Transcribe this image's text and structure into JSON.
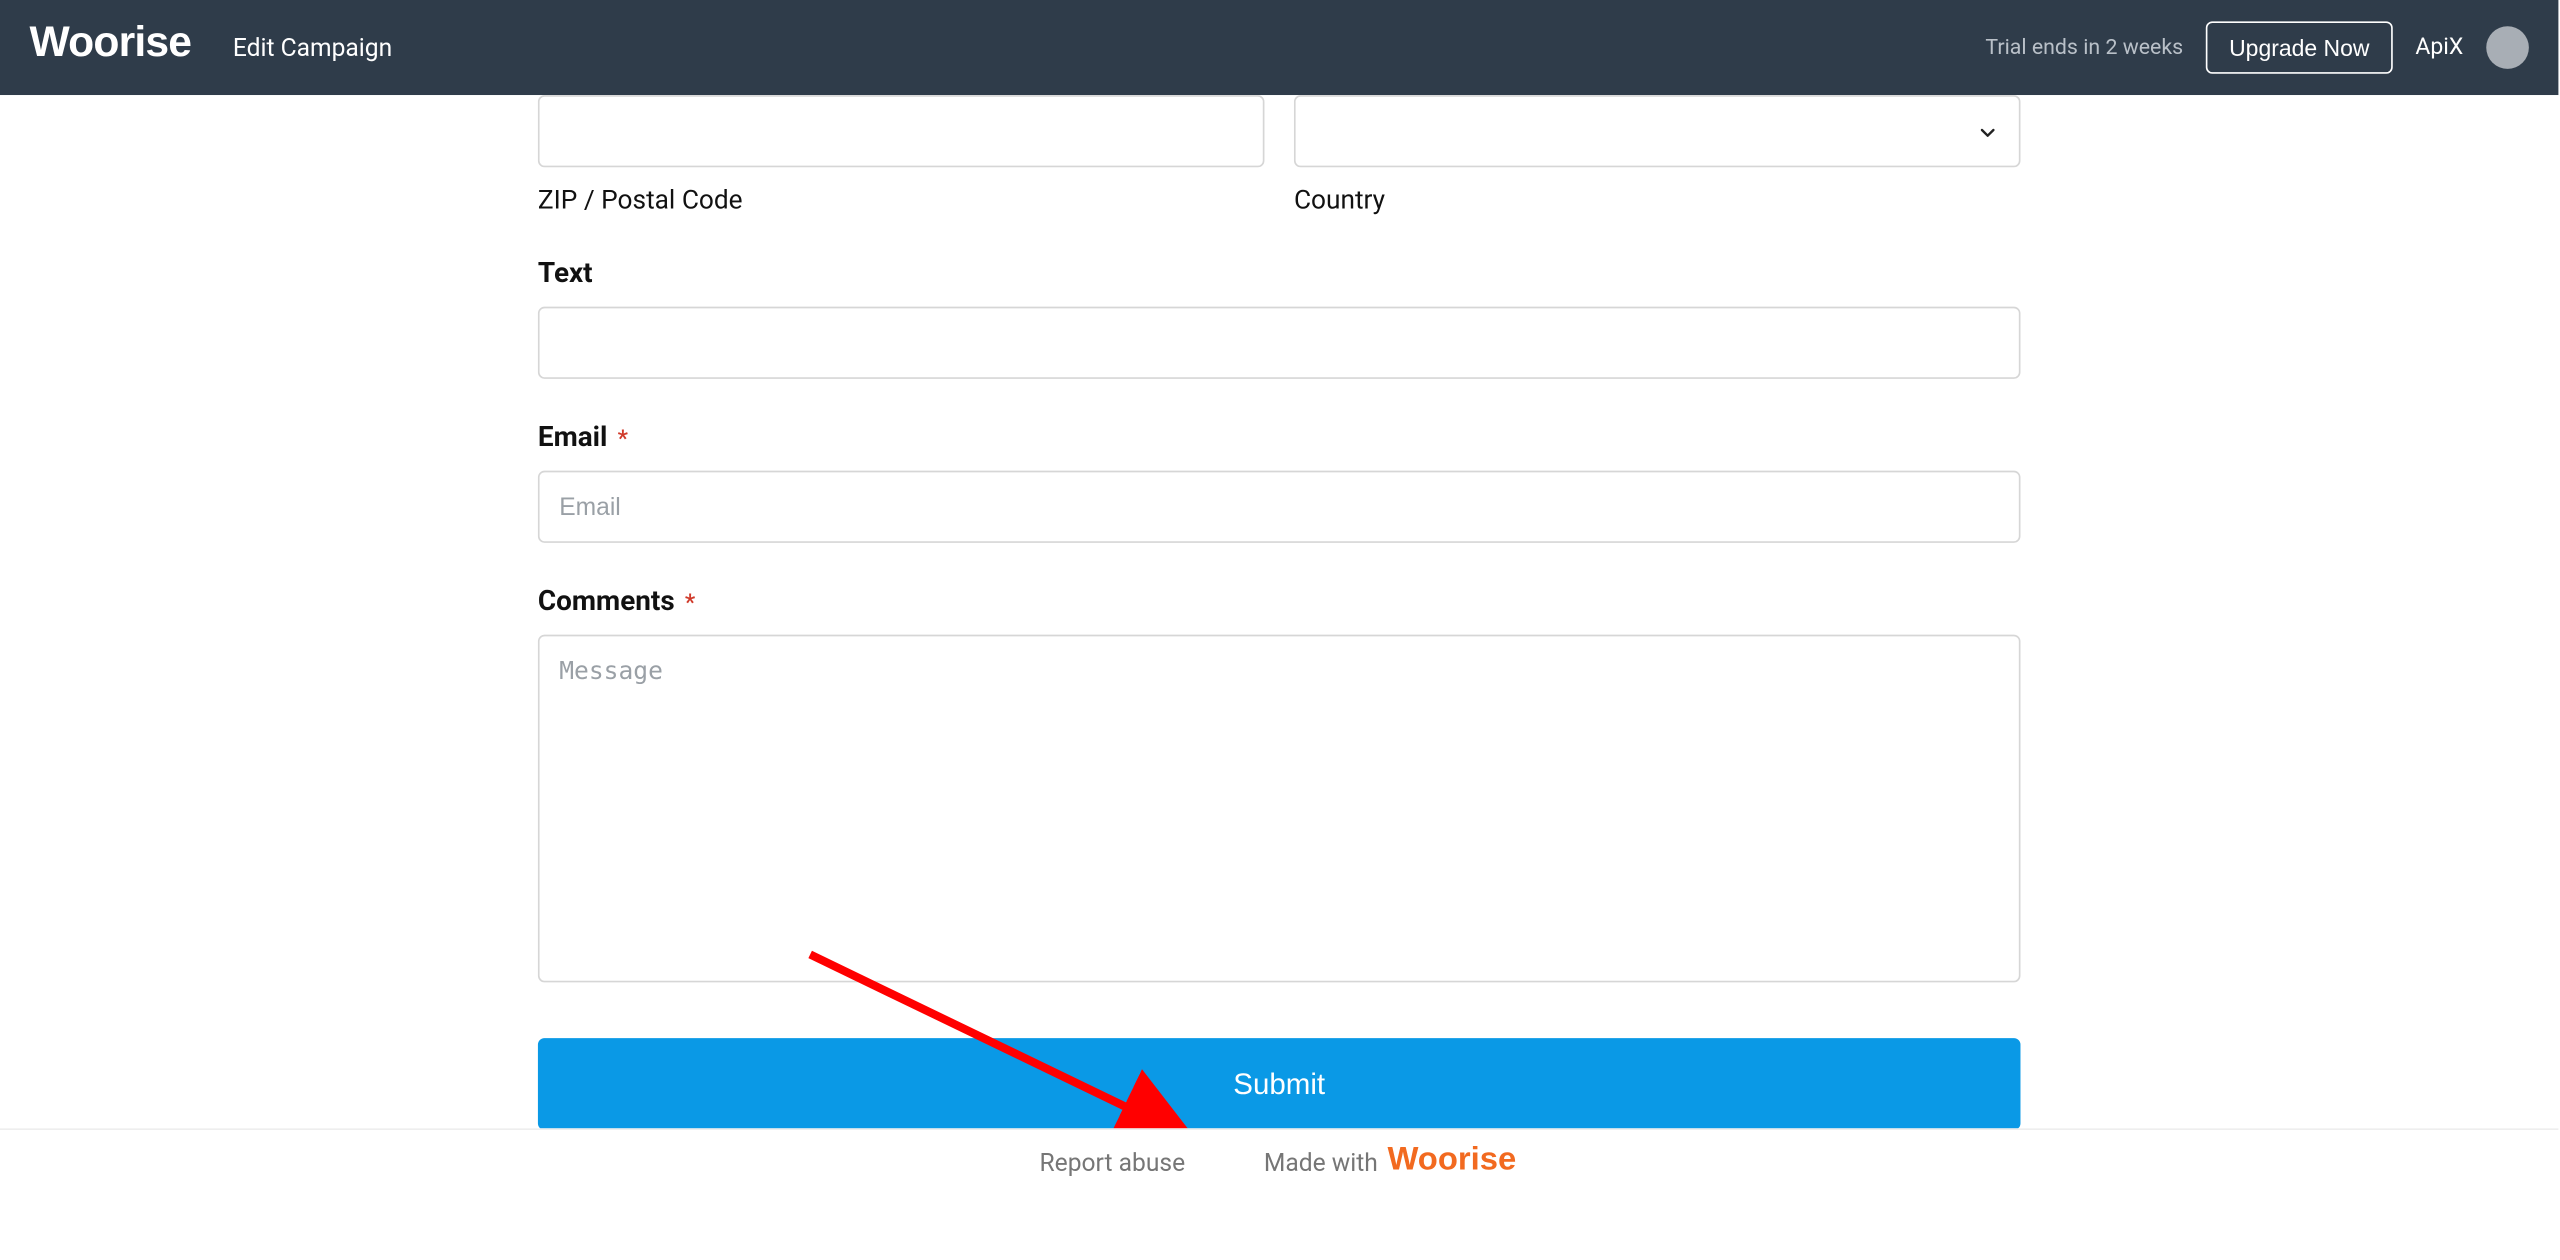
{
  "header": {
    "logo": "Woorise",
    "title": "Edit Campaign",
    "trial_text": "Trial ends in 2 weeks",
    "upgrade_label": "Upgrade Now",
    "user_name": "ApiX"
  },
  "form": {
    "zip_sublabel": "ZIP / Postal Code",
    "country_sublabel": "Country",
    "text_label": "Text",
    "email_label": "Email",
    "email_placeholder": "Email",
    "comments_label": "Comments",
    "comments_placeholder": "Message",
    "submit_label": "Submit",
    "required_mark": "*"
  },
  "footer": {
    "report_abuse": "Report abuse",
    "made_with": "Made with",
    "brand": "Woorise"
  }
}
